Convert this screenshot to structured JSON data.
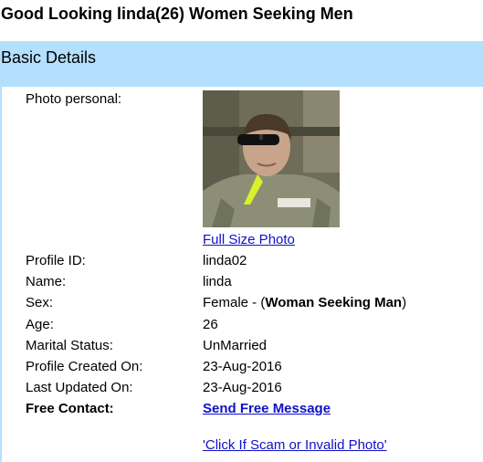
{
  "page": {
    "title": "Good Looking linda(26) Women Seeking Men"
  },
  "section": {
    "title": "Basic Details"
  },
  "photo": {
    "label": "Photo personal:",
    "full_size_link": "Full Size Photo"
  },
  "fields": [
    {
      "label": "Profile ID:",
      "value": "linda02"
    },
    {
      "label": "Name:",
      "value": "linda"
    },
    {
      "label": "Sex:",
      "value_prefix": "Female - (",
      "value_bold": "Woman Seeking Man",
      "value_suffix": ")"
    },
    {
      "label": "Age:",
      "value": "26"
    },
    {
      "label": "Marital Status:",
      "value": "UnMarried"
    },
    {
      "label": "Profile Created On:",
      "value": "23-Aug-2016"
    },
    {
      "label": "Last Updated On:",
      "value": "23-Aug-2016"
    }
  ],
  "contact": {
    "label": "Free Contact:",
    "link": "Send Free Message"
  },
  "scam_link": "'Click If Scam or Invalid Photo'",
  "colors": {
    "section_bg": "#b3e0fd",
    "link": "#1010c8"
  }
}
